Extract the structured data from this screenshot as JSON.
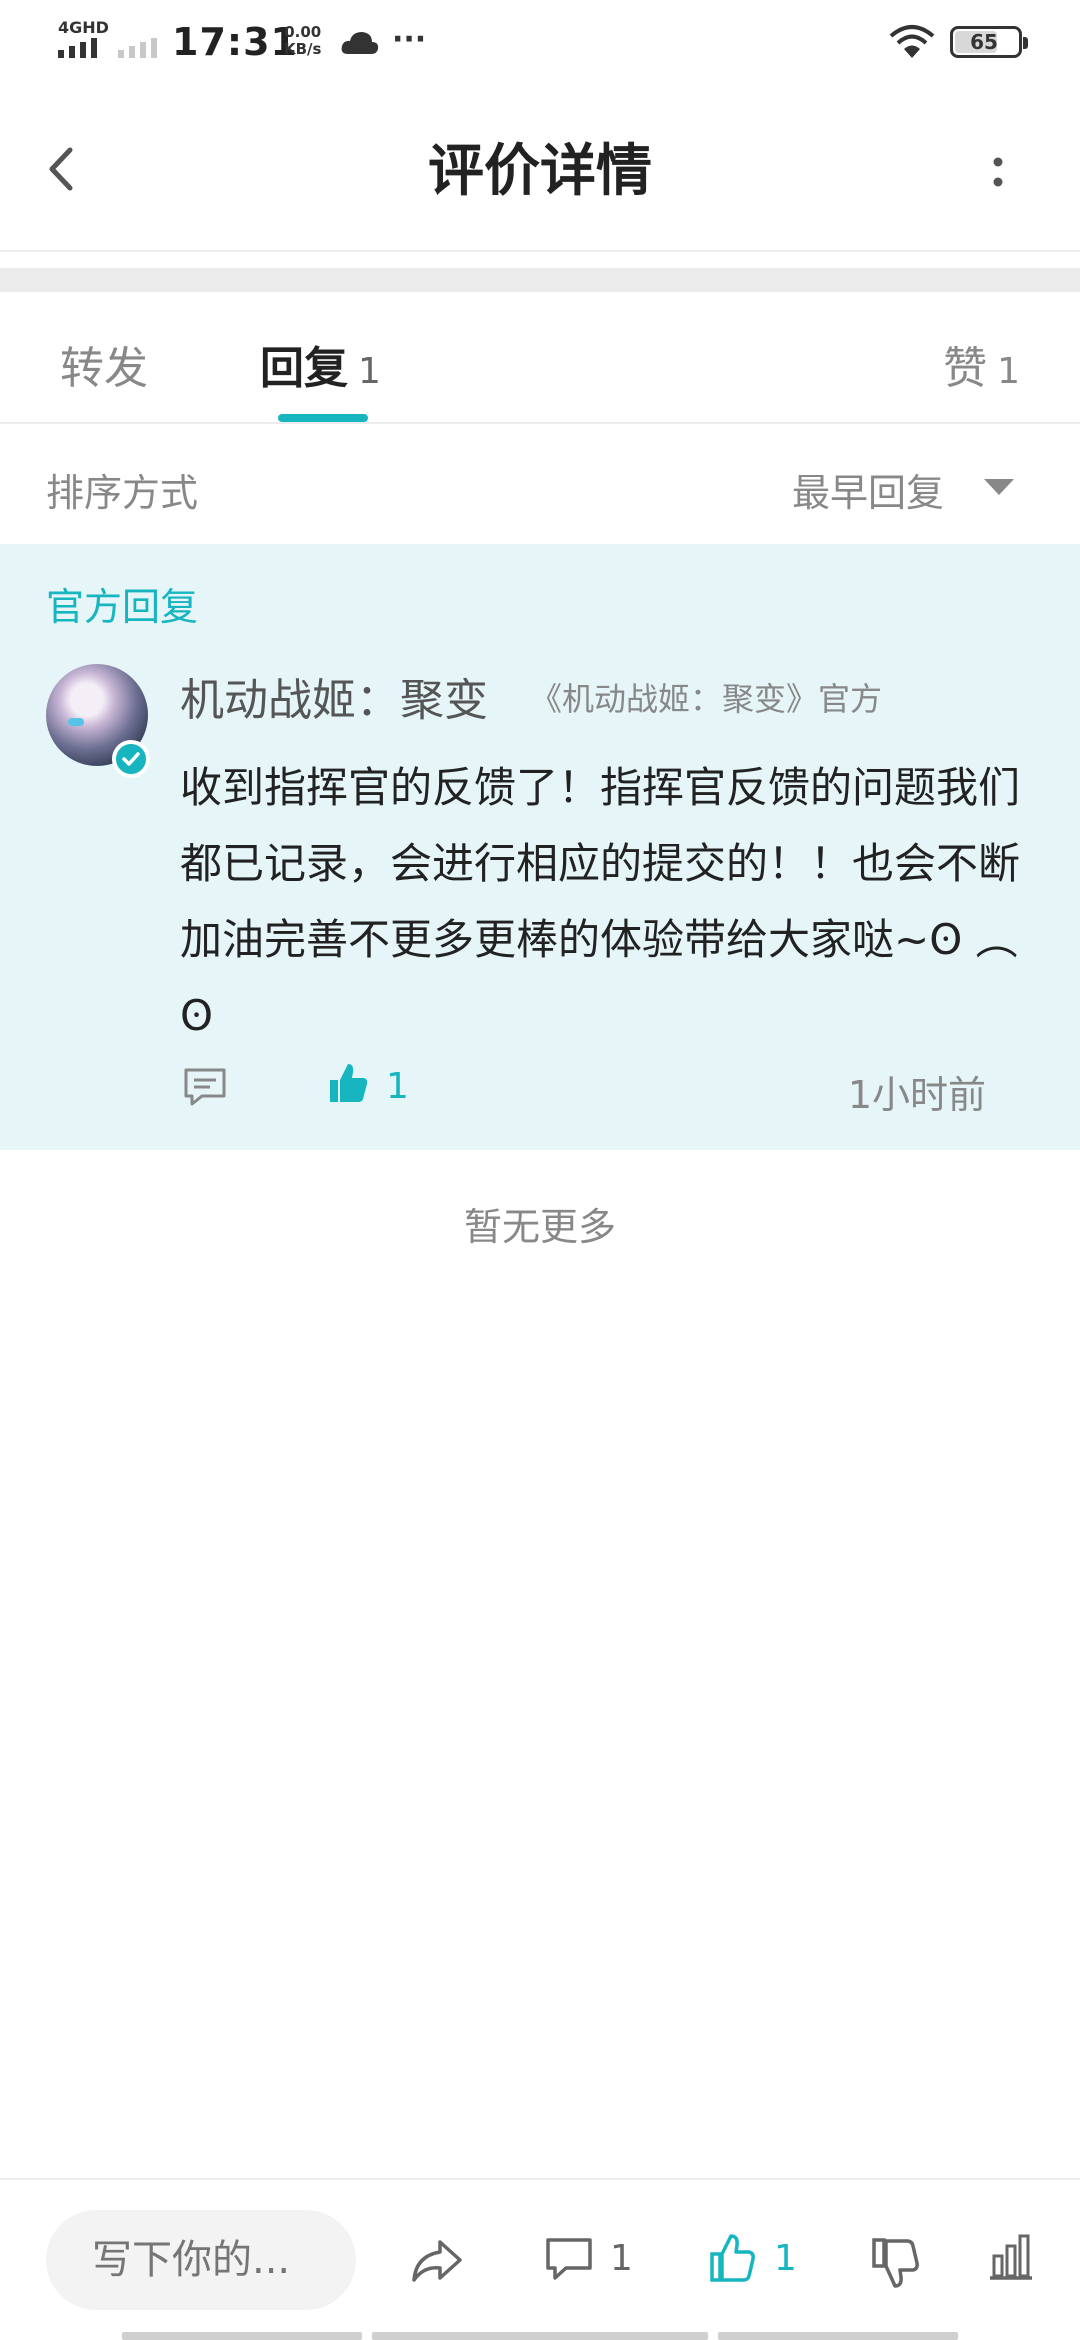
{
  "status_bar": {
    "network": "4GHD",
    "time": "17:31",
    "speed_value": "0.00",
    "speed_unit": "KB/s",
    "dots": "···",
    "battery": "65"
  },
  "header": {
    "title": "评价详情"
  },
  "tabs": {
    "forward_label": "转发",
    "reply_label": "回复",
    "reply_count": "1",
    "like_label": "赞",
    "like_count": "1"
  },
  "sort": {
    "label": "排序方式",
    "value": "最早回复"
  },
  "official_reply": {
    "section_label": "官方回复",
    "author": "机动战姬：聚变",
    "tag": "《机动战姬：聚变》官方",
    "text": "收到指挥官的反馈了！指挥官反馈的问题我们都已记录，会进行相应的提交的！！也会不断加油完善不更多更棒的体验带给大家哒~ʘ ︵ ʘ",
    "like_count": "1",
    "time": "1小时前"
  },
  "no_more": "暂无更多",
  "bottom_bar": {
    "input_placeholder": "写下你的...",
    "comment_count": "1",
    "like_count": "1"
  },
  "colors": {
    "accent": "#16b5c0",
    "card_bg": "#e5f5f8",
    "muted": "#888888"
  }
}
